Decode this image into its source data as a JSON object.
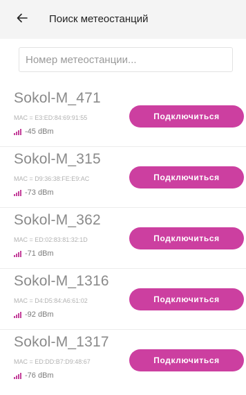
{
  "header": {
    "title": "Поиск метеостанций",
    "back_icon": "arrow-left-icon"
  },
  "search": {
    "placeholder": "Номер метеостанции...",
    "value": ""
  },
  "colors": {
    "accent": "#cc3fa0",
    "header_bg": "#f4f4f4"
  },
  "stations": [
    {
      "name": "Sokol-M_471",
      "mac": "MAC = E3:ED:84:69:91:55",
      "rssi": "-45 dBm",
      "button": "Подключиться"
    },
    {
      "name": "Sokol-M_315",
      "mac": "MAC = D9:36:38:FE:E9:AC",
      "rssi": "-73 dBm",
      "button": "Подключиться"
    },
    {
      "name": "Sokol-M_362",
      "mac": "MAC = ED:02:83:81:32:1D",
      "rssi": "-71 dBm",
      "button": "Подключиться"
    },
    {
      "name": "Sokol-M_1316",
      "mac": "MAC = D4:D5:84:A6:61:02",
      "rssi": "-92 dBm",
      "button": "Подключиться"
    },
    {
      "name": "Sokol-M_1317",
      "mac": "MAC = ED:DD:B7:D9:48:67",
      "rssi": "-76 dBm",
      "button": "Подключиться"
    }
  ]
}
